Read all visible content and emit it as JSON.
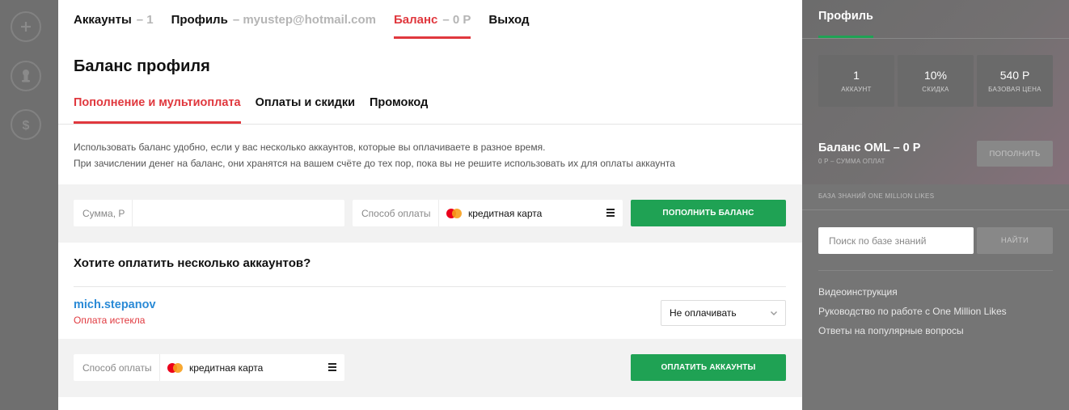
{
  "topnav": {
    "accounts_label": "Аккаунты",
    "accounts_count": "– 1",
    "profile_label": "Профиль",
    "profile_email": "– myustep@hotmail.com",
    "balance_label": "Баланс",
    "balance_value": "– 0 Р",
    "logout_label": "Выход"
  },
  "page": {
    "title": "Баланс профиля",
    "tabs": [
      "Пополнение и мультиоплата",
      "Оплаты и скидки",
      "Промокод"
    ],
    "desc_line1": "Использовать баланс удобно, если у вас несколько аккаунтов, которые вы оплачиваете в разное время.",
    "desc_line2": "При зачислении денег на баланс, они хранятся на вашем счёте до тех пор, пока вы не решите использовать их для оплаты аккаунта"
  },
  "topup": {
    "amount_label": "Сумма, Р",
    "amount_value": "",
    "method_label": "Способ оплаты",
    "method_value": "кредитная карта",
    "button": "Пополнить баланс"
  },
  "multipay": {
    "heading": "Хотите оплатить несколько аккаунтов?",
    "account_name": "mich.stepanov",
    "account_status": "Оплата истекла",
    "select_value": "Не оплачивать",
    "method_label": "Способ оплаты",
    "method_value": "кредитная карта",
    "button": "Оплатить аккаунты"
  },
  "right": {
    "title": "Профиль",
    "stats": [
      {
        "value": "1",
        "caption": "Аккаунт"
      },
      {
        "value": "10%",
        "caption": "Скидка"
      },
      {
        "value": "540 Р",
        "caption": "Базовая цена"
      }
    ],
    "balance_title": "Баланс OML – 0 Р",
    "balance_sub": "0 Р – сумма оплат",
    "topup_button": "Пополнить",
    "kb_label": "База знаний One Million Likes",
    "search_placeholder": "Поиск по базе знаний",
    "find_button": "Найти",
    "links": [
      "Видеоинструкция",
      "Руководство по работе с One Million Likes",
      "Ответы на популярные вопросы"
    ]
  },
  "colors": {
    "accent_red": "#e0383e",
    "accent_green": "#1fa254",
    "link_blue": "#2a8ad6"
  },
  "icons": [
    "plus-icon",
    "user-icon",
    "dollar-icon",
    "mastercard-icon",
    "menu-icon",
    "chevron-down-icon"
  ]
}
